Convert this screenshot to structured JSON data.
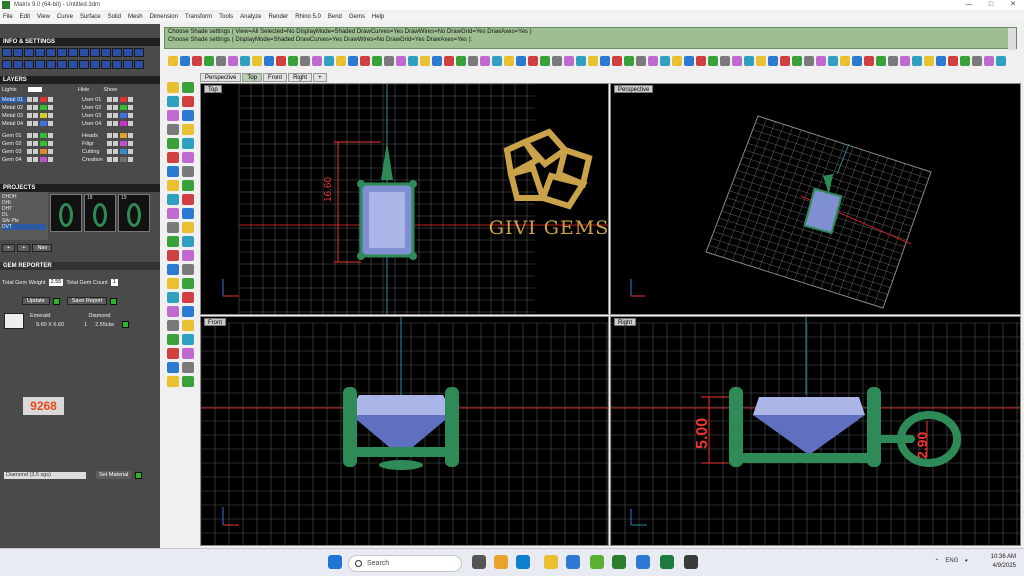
{
  "window": {
    "title": "Matrix 9.0 (64-bit) - Untitled.3dm"
  },
  "menu": [
    "File",
    "Edit",
    "View",
    "Curve",
    "Surface",
    "Solid",
    "Mesh",
    "Dimension",
    "Transform",
    "Tools",
    "Analyze",
    "Render",
    "Rhino 5.0",
    "Bend",
    "Gems",
    "Help"
  ],
  "command": {
    "line1": "Choose Shade settings ( View=All  Selected=No  DisplayMode=Shaded  DrawCurves=Yes  DrawWires=No  DrawGrid=Yes  DrawAxes=Yes )",
    "line2": "Choose Shade settings ( DisplayMode=Shaded  DrawCurves=Yes  DrawWires=No  DrawGrid=Yes  DrawAxes=Yes ):"
  },
  "left": {
    "info_title": "INFO & SETTINGS",
    "layers_title": "LAYERS",
    "lights_label": "Lights",
    "layer_headers": {
      "hide": "Hide",
      "show": "Show"
    },
    "layers_left": [
      {
        "name": "Metal 01",
        "color": "#e03131",
        "selected": true
      },
      {
        "name": "Metal 02",
        "color": "#2fbf2f"
      },
      {
        "name": "Metal 03",
        "color": "#cfcf2f"
      },
      {
        "name": "Metal 04",
        "color": "#3f6fe0"
      },
      {
        "name": "Gem 01",
        "color": "#2fbf2f"
      },
      {
        "name": "Gem 02",
        "color": "#2fbf2f"
      },
      {
        "name": "Gem 03",
        "color": "#e08a2f"
      },
      {
        "name": "Gem 04",
        "color": "#c04fd0"
      }
    ],
    "layers_right": [
      {
        "name": "User 01",
        "color": "#e03131"
      },
      {
        "name": "User 02",
        "color": "#2fbf2f"
      },
      {
        "name": "User 03",
        "color": "#3f6fe0"
      },
      {
        "name": "User 04",
        "color": "#cf2fcf"
      },
      {
        "name": "Heads",
        "color": "#e0a02f"
      },
      {
        "name": "Filigr",
        "color": "#c04fd0"
      },
      {
        "name": "Cutting",
        "color": "#2f8fd0"
      },
      {
        "name": "Creation",
        "color": "#6f6f6f"
      }
    ],
    "projects_title": "PROJECTS",
    "projects_list": [
      "DHDH",
      "DHI",
      "DHT",
      "DL",
      "Silv Pts",
      "DVT"
    ],
    "project_thumbs": [
      "18",
      "19"
    ],
    "nav_label": "Nav",
    "gem_reporter_title": "GEM REPORTER",
    "total_weight_label": "Total Gem Weight",
    "total_weight_value": "2.55",
    "total_count_label": "Total Gem Count",
    "total_count_value": "1",
    "update_label": "Update",
    "save_report_label": "Save Report",
    "gem_table": {
      "headers": [
        "Emerald",
        "Diamond"
      ],
      "row": {
        "size": "9.60 X 6.60",
        "count": "1",
        "ct": "2.55ctw"
      }
    },
    "badge": "9268",
    "material_select": "Diamond (3.5 sgs)",
    "set_material_label": "Set Material"
  },
  "viewport_tabs": [
    "Perspective",
    "Top",
    "Front",
    "Right",
    "+"
  ],
  "viewports": {
    "top": "Top",
    "perspective": "Perspective",
    "front": "Front",
    "right": "Right"
  },
  "dimensions": {
    "top_length": "16.60",
    "right_height": "5.00",
    "right_bail": "2.90"
  },
  "watermark": "GIVI GEMS",
  "taskbar": {
    "search": "Search",
    "lang": "ENG",
    "time": "10:36 AM",
    "date": "4/9/2025"
  }
}
